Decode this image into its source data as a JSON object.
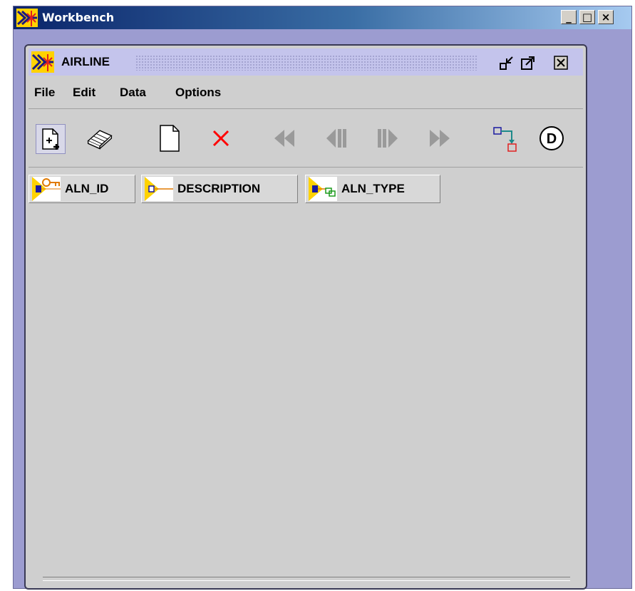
{
  "window": {
    "title": "Workbench",
    "buttons": {
      "minimize": "_",
      "maximize": "□",
      "close": "×"
    }
  },
  "frame": {
    "title": "AIRLINE"
  },
  "menu": {
    "items": [
      {
        "label": "File"
      },
      {
        "label": "Edit"
      },
      {
        "label": "Data"
      },
      {
        "label": "Options"
      }
    ]
  },
  "toolbar": {
    "buttons": [
      {
        "icon": "new-record-icon"
      },
      {
        "icon": "eraser-icon"
      },
      {
        "icon": "blank-page-icon"
      },
      {
        "icon": "delete-icon"
      },
      {
        "icon": "first-record-icon"
      },
      {
        "icon": "previous-record-icon"
      },
      {
        "icon": "next-record-icon"
      },
      {
        "icon": "last-record-icon"
      },
      {
        "icon": "relation-icon"
      },
      {
        "icon": "details-icon"
      }
    ],
    "details_label": "D"
  },
  "columns": [
    {
      "label": "ALN_ID",
      "icon": "primary-key-icon"
    },
    {
      "label": "DESCRIPTION",
      "icon": "attribute-icon"
    },
    {
      "label": "ALN_TYPE",
      "icon": "foreign-key-icon"
    }
  ],
  "colors": {
    "outer_bg": "#9c9cd0",
    "title_gradient_start": "#0a246a",
    "inner_bg": "#cfcfcf",
    "inner_title_bg": "#c4c4ec",
    "delete_red": "#ff0000",
    "logo_yellow": "#ffd200"
  }
}
